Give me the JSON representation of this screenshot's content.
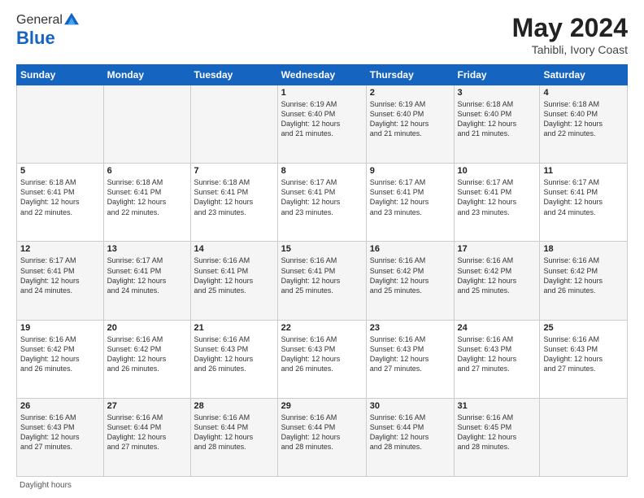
{
  "logo": {
    "general": "General",
    "blue": "Blue"
  },
  "title": {
    "month_year": "May 2024",
    "location": "Tahibli, Ivory Coast"
  },
  "header_days": [
    "Sunday",
    "Monday",
    "Tuesday",
    "Wednesday",
    "Thursday",
    "Friday",
    "Saturday"
  ],
  "weeks": [
    [
      {
        "day": "",
        "info": ""
      },
      {
        "day": "",
        "info": ""
      },
      {
        "day": "",
        "info": ""
      },
      {
        "day": "1",
        "info": "Sunrise: 6:19 AM\nSunset: 6:40 PM\nDaylight: 12 hours\nand 21 minutes."
      },
      {
        "day": "2",
        "info": "Sunrise: 6:19 AM\nSunset: 6:40 PM\nDaylight: 12 hours\nand 21 minutes."
      },
      {
        "day": "3",
        "info": "Sunrise: 6:18 AM\nSunset: 6:40 PM\nDaylight: 12 hours\nand 21 minutes."
      },
      {
        "day": "4",
        "info": "Sunrise: 6:18 AM\nSunset: 6:40 PM\nDaylight: 12 hours\nand 22 minutes."
      }
    ],
    [
      {
        "day": "5",
        "info": "Sunrise: 6:18 AM\nSunset: 6:41 PM\nDaylight: 12 hours\nand 22 minutes."
      },
      {
        "day": "6",
        "info": "Sunrise: 6:18 AM\nSunset: 6:41 PM\nDaylight: 12 hours\nand 22 minutes."
      },
      {
        "day": "7",
        "info": "Sunrise: 6:18 AM\nSunset: 6:41 PM\nDaylight: 12 hours\nand 23 minutes."
      },
      {
        "day": "8",
        "info": "Sunrise: 6:17 AM\nSunset: 6:41 PM\nDaylight: 12 hours\nand 23 minutes."
      },
      {
        "day": "9",
        "info": "Sunrise: 6:17 AM\nSunset: 6:41 PM\nDaylight: 12 hours\nand 23 minutes."
      },
      {
        "day": "10",
        "info": "Sunrise: 6:17 AM\nSunset: 6:41 PM\nDaylight: 12 hours\nand 23 minutes."
      },
      {
        "day": "11",
        "info": "Sunrise: 6:17 AM\nSunset: 6:41 PM\nDaylight: 12 hours\nand 24 minutes."
      }
    ],
    [
      {
        "day": "12",
        "info": "Sunrise: 6:17 AM\nSunset: 6:41 PM\nDaylight: 12 hours\nand 24 minutes."
      },
      {
        "day": "13",
        "info": "Sunrise: 6:17 AM\nSunset: 6:41 PM\nDaylight: 12 hours\nand 24 minutes."
      },
      {
        "day": "14",
        "info": "Sunrise: 6:16 AM\nSunset: 6:41 PM\nDaylight: 12 hours\nand 25 minutes."
      },
      {
        "day": "15",
        "info": "Sunrise: 6:16 AM\nSunset: 6:41 PM\nDaylight: 12 hours\nand 25 minutes."
      },
      {
        "day": "16",
        "info": "Sunrise: 6:16 AM\nSunset: 6:42 PM\nDaylight: 12 hours\nand 25 minutes."
      },
      {
        "day": "17",
        "info": "Sunrise: 6:16 AM\nSunset: 6:42 PM\nDaylight: 12 hours\nand 25 minutes."
      },
      {
        "day": "18",
        "info": "Sunrise: 6:16 AM\nSunset: 6:42 PM\nDaylight: 12 hours\nand 26 minutes."
      }
    ],
    [
      {
        "day": "19",
        "info": "Sunrise: 6:16 AM\nSunset: 6:42 PM\nDaylight: 12 hours\nand 26 minutes."
      },
      {
        "day": "20",
        "info": "Sunrise: 6:16 AM\nSunset: 6:42 PM\nDaylight: 12 hours\nand 26 minutes."
      },
      {
        "day": "21",
        "info": "Sunrise: 6:16 AM\nSunset: 6:43 PM\nDaylight: 12 hours\nand 26 minutes."
      },
      {
        "day": "22",
        "info": "Sunrise: 6:16 AM\nSunset: 6:43 PM\nDaylight: 12 hours\nand 26 minutes."
      },
      {
        "day": "23",
        "info": "Sunrise: 6:16 AM\nSunset: 6:43 PM\nDaylight: 12 hours\nand 27 minutes."
      },
      {
        "day": "24",
        "info": "Sunrise: 6:16 AM\nSunset: 6:43 PM\nDaylight: 12 hours\nand 27 minutes."
      },
      {
        "day": "25",
        "info": "Sunrise: 6:16 AM\nSunset: 6:43 PM\nDaylight: 12 hours\nand 27 minutes."
      }
    ],
    [
      {
        "day": "26",
        "info": "Sunrise: 6:16 AM\nSunset: 6:43 PM\nDaylight: 12 hours\nand 27 minutes."
      },
      {
        "day": "27",
        "info": "Sunrise: 6:16 AM\nSunset: 6:44 PM\nDaylight: 12 hours\nand 27 minutes."
      },
      {
        "day": "28",
        "info": "Sunrise: 6:16 AM\nSunset: 6:44 PM\nDaylight: 12 hours\nand 28 minutes."
      },
      {
        "day": "29",
        "info": "Sunrise: 6:16 AM\nSunset: 6:44 PM\nDaylight: 12 hours\nand 28 minutes."
      },
      {
        "day": "30",
        "info": "Sunrise: 6:16 AM\nSunset: 6:44 PM\nDaylight: 12 hours\nand 28 minutes."
      },
      {
        "day": "31",
        "info": "Sunrise: 6:16 AM\nSunset: 6:45 PM\nDaylight: 12 hours\nand 28 minutes."
      },
      {
        "day": "",
        "info": ""
      }
    ]
  ],
  "footer": {
    "note": "Daylight hours"
  }
}
